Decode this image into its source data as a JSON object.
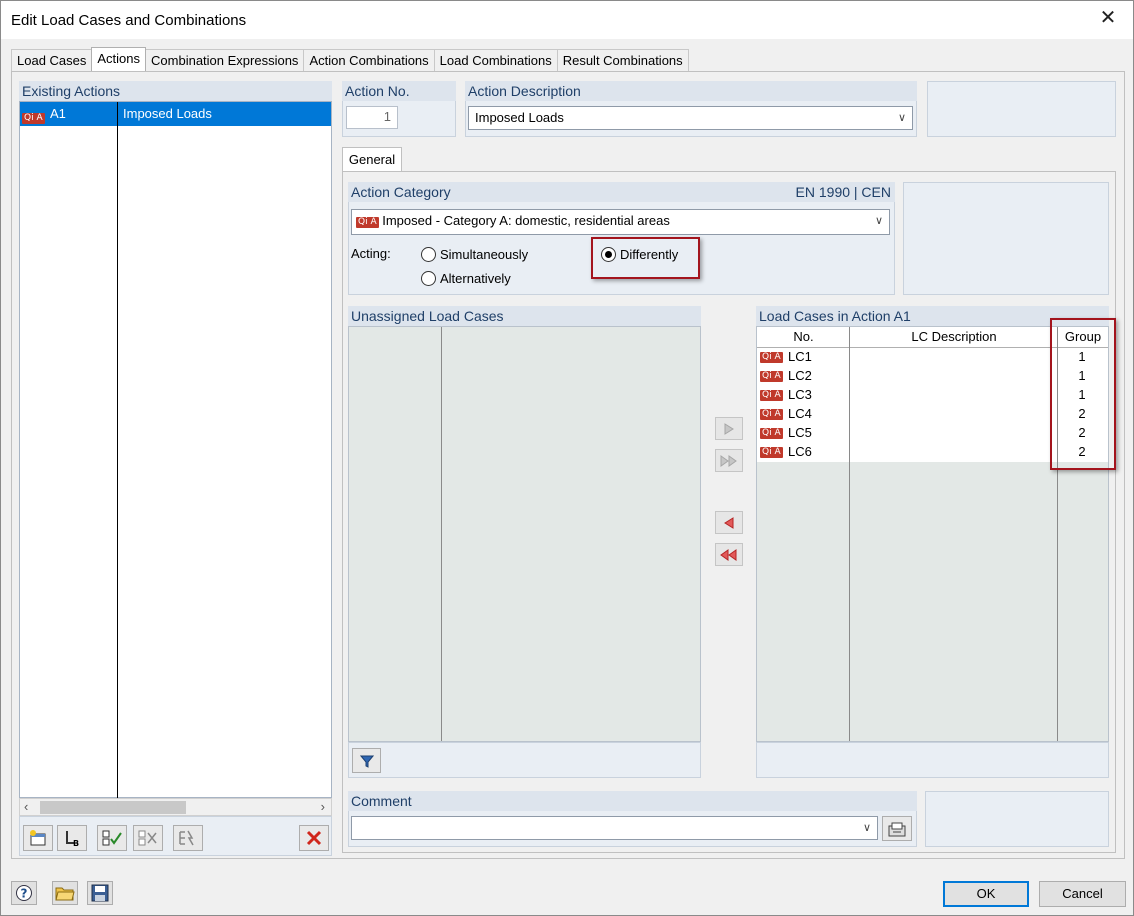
{
  "window": {
    "title": "Edit Load Cases and Combinations"
  },
  "tabs": [
    "Load Cases",
    "Actions",
    "Combination Expressions",
    "Action Combinations",
    "Load Combinations",
    "Result Combinations"
  ],
  "existing_actions": {
    "header": "Existing Actions",
    "rows": [
      {
        "tag": "Qi A",
        "id": "A1",
        "description": "Imposed Loads"
      }
    ]
  },
  "action_no": {
    "label": "Action No.",
    "value": "1"
  },
  "action_description": {
    "label": "Action Description",
    "value": "Imposed Loads"
  },
  "subtab": "General",
  "action_category": {
    "label": "Action Category",
    "standard": "EN 1990 | CEN",
    "tag": "Qi A",
    "value": "Imposed - Category A: domestic, residential areas"
  },
  "acting": {
    "label": "Acting:",
    "options": [
      "Simultaneously",
      "Alternatively",
      "Differently"
    ],
    "selected": "Differently"
  },
  "unassigned": {
    "header": "Unassigned Load Cases"
  },
  "assigned": {
    "header": "Load Cases in Action A1",
    "columns": [
      "No.",
      "LC Description",
      "Group"
    ],
    "rows": [
      {
        "tag": "Qi A",
        "no": "LC1",
        "description": "",
        "group": "1"
      },
      {
        "tag": "Qi A",
        "no": "LC2",
        "description": "",
        "group": "1"
      },
      {
        "tag": "Qi A",
        "no": "LC3",
        "description": "",
        "group": "1"
      },
      {
        "tag": "Qi A",
        "no": "LC4",
        "description": "",
        "group": "2"
      },
      {
        "tag": "Qi A",
        "no": "LC5",
        "description": "",
        "group": "2"
      },
      {
        "tag": "Qi A",
        "no": "LC6",
        "description": "",
        "group": "2"
      }
    ]
  },
  "comment": {
    "label": "Comment",
    "value": ""
  },
  "buttons": {
    "ok": "OK",
    "cancel": "Cancel"
  },
  "icons": {
    "new_action": "new-action-icon",
    "renumber": "renumber-icon",
    "check_all": "check-all-icon",
    "uncheck_all": "uncheck-all-icon",
    "generate": "generate-icon",
    "delete": "delete-icon",
    "filter": "filter-icon",
    "help": "help-icon",
    "open": "open-icon",
    "save": "save-icon"
  },
  "colors": {
    "accent": "#0078d7",
    "header_text": "#1f3f68",
    "tag": "#c0392b",
    "highlight": "#a3141d"
  }
}
